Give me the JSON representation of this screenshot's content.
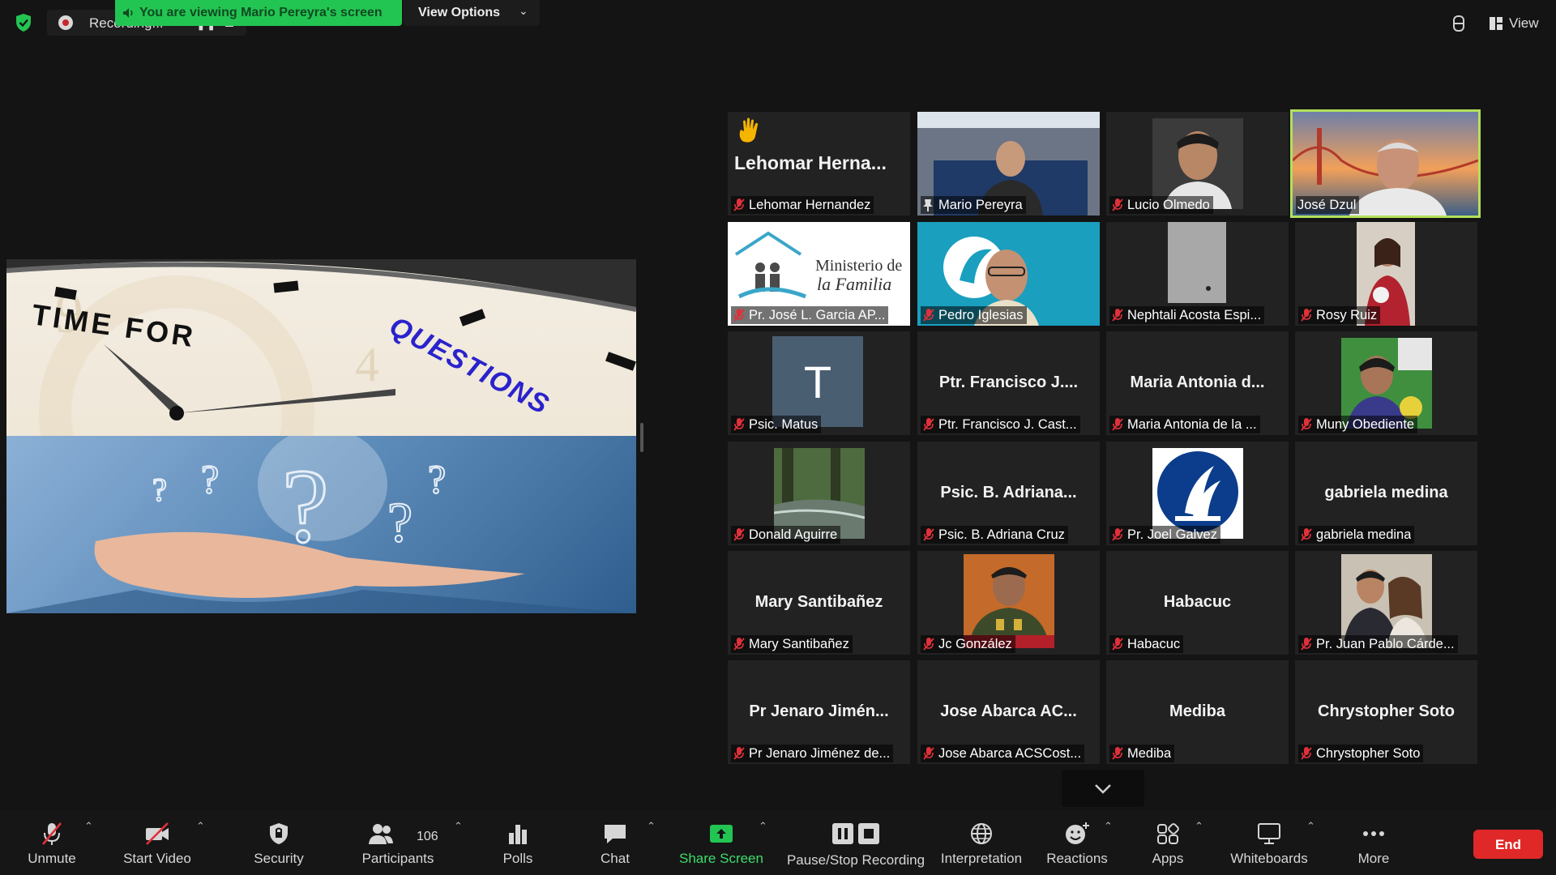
{
  "meeting": {
    "recording_label": "Recording...",
    "viewing_banner": "You are viewing Mario Pereyra's screen",
    "view_options": "View Options",
    "view_label": "View"
  },
  "shared_screen": {
    "headline": "TIME FOR QUESTIONS",
    "headline_part1": "TIME FOR",
    "headline_part2": "QUESTIONS"
  },
  "participants_tiles": [
    {
      "display": "Lehomar  Herna...",
      "label": "Lehomar Hernandez",
      "raised_hand": true
    },
    {
      "display": "",
      "label": "Mario Pereyra",
      "pinned": true
    },
    {
      "display": "",
      "label": "Lucio Olmedo"
    },
    {
      "display": "",
      "label": "José Dzul",
      "active_speaker": true
    },
    {
      "display": "",
      "label": "Pr. José L. Garcia AP...",
      "logo_text_1": "Ministerio de",
      "logo_text_2": "la Familia"
    },
    {
      "display": "",
      "label": "Pedro Iglesias"
    },
    {
      "display": "",
      "label": "Nephtali Acosta Espi..."
    },
    {
      "display": "",
      "label": "Rosy Ruiz"
    },
    {
      "display": "T",
      "label": "Psic. Matus"
    },
    {
      "display": "Ptr. Francisco  J....",
      "label": "Ptr. Francisco  J. Cast..."
    },
    {
      "display": "Maria Antonia d...",
      "label": "Maria Antonia de la ..."
    },
    {
      "display": "",
      "label": "Muny Obediente"
    },
    {
      "display": "",
      "label": "Donald Aguirre"
    },
    {
      "display": "Psic. B. Adriana...",
      "label": "Psic. B. Adriana Cruz"
    },
    {
      "display": "",
      "label": "Pr. Joel Galvez"
    },
    {
      "display": "gabriela medina",
      "label": "gabriela medina"
    },
    {
      "display": "Mary Santibañez",
      "label": "Mary Santibañez"
    },
    {
      "display": "",
      "label": "Jc González"
    },
    {
      "display": "Habacuc",
      "label": "Habacuc"
    },
    {
      "display": "",
      "label": "Pr. Juan Pablo Cárde..."
    },
    {
      "display": "Pr Jenaro Jimén...",
      "label": "Pr Jenaro Jiménez de..."
    },
    {
      "display": "Jose Abarca AC...",
      "label": "Jose Abarca ACSCost..."
    },
    {
      "display": "Mediba",
      "label": "Mediba"
    },
    {
      "display": "Chrystopher Soto",
      "label": "Chrystopher Soto"
    }
  ],
  "toolbar": {
    "unmute": "Unmute",
    "start_video": "Start Video",
    "security": "Security",
    "participants": "Participants",
    "participants_count": "106",
    "polls": "Polls",
    "chat": "Chat",
    "share_screen": "Share Screen",
    "pause_stop_recording": "Pause/Stop Recording",
    "interpretation": "Interpretation",
    "reactions": "Reactions",
    "apps": "Apps",
    "whiteboards": "Whiteboards",
    "more": "More",
    "end": "End"
  },
  "colors": {
    "background": "#141414",
    "banner_green": "#23c552",
    "share_green": "#23c552",
    "active_border": "#b3e05a",
    "end_red": "#e02828",
    "mute_red": "#e0303a"
  }
}
